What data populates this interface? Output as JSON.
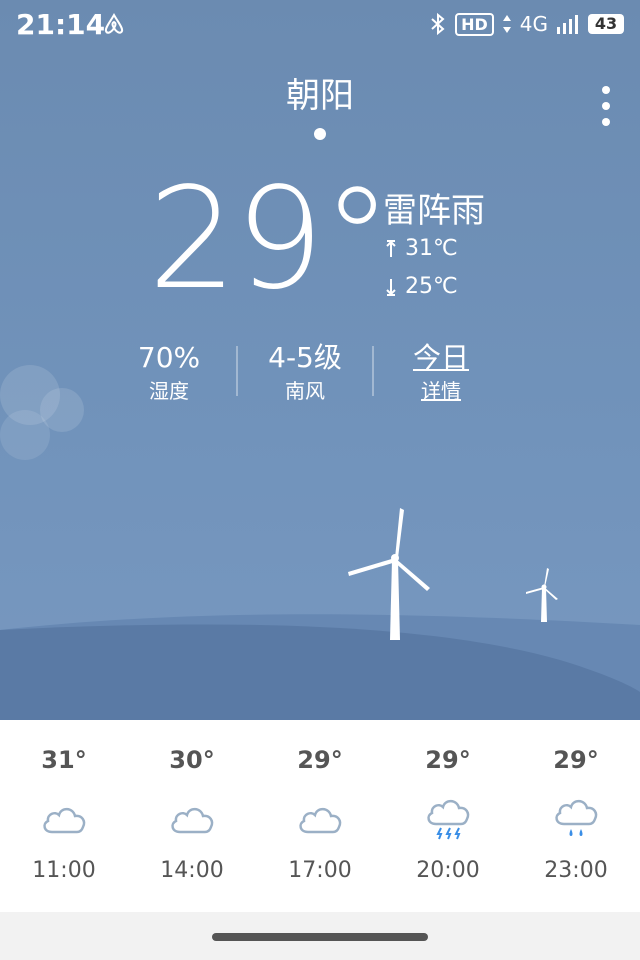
{
  "status": {
    "time": "21:14",
    "hd_label": "HD",
    "network_label": "4G",
    "battery": "43",
    "icons": [
      "airbnb-like-icon",
      "bluetooth-icon",
      "hd-icon",
      "data-arrows-icon",
      "signal-icon",
      "battery-icon"
    ]
  },
  "location": {
    "city": "朝阳"
  },
  "current": {
    "temperature": "29°",
    "condition": "雷阵雨",
    "high": "31℃",
    "low": "25℃"
  },
  "metrics": {
    "humidity": {
      "value": "70%",
      "label": "湿度"
    },
    "wind": {
      "value": "4-5级",
      "label": "南风"
    },
    "today": {
      "value": "今日",
      "label": "详情"
    }
  },
  "forecast": [
    {
      "temp": "31°",
      "icon": "cloud-icon",
      "time": "11:00"
    },
    {
      "temp": "30°",
      "icon": "cloud-icon",
      "time": "14:00"
    },
    {
      "temp": "29°",
      "icon": "cloud-icon",
      "time": "17:00"
    },
    {
      "temp": "29°",
      "icon": "thunder-rain-icon",
      "time": "20:00"
    },
    {
      "temp": "29°",
      "icon": "rain-cloud-icon",
      "time": "23:00"
    }
  ],
  "colors": {
    "sky": "#6b8bb1",
    "hill_back": "#6788b3",
    "hill_front": "#5a7aa5",
    "icon_outline": "#9bb0c6",
    "rain_drop": "#3a8ee6"
  }
}
